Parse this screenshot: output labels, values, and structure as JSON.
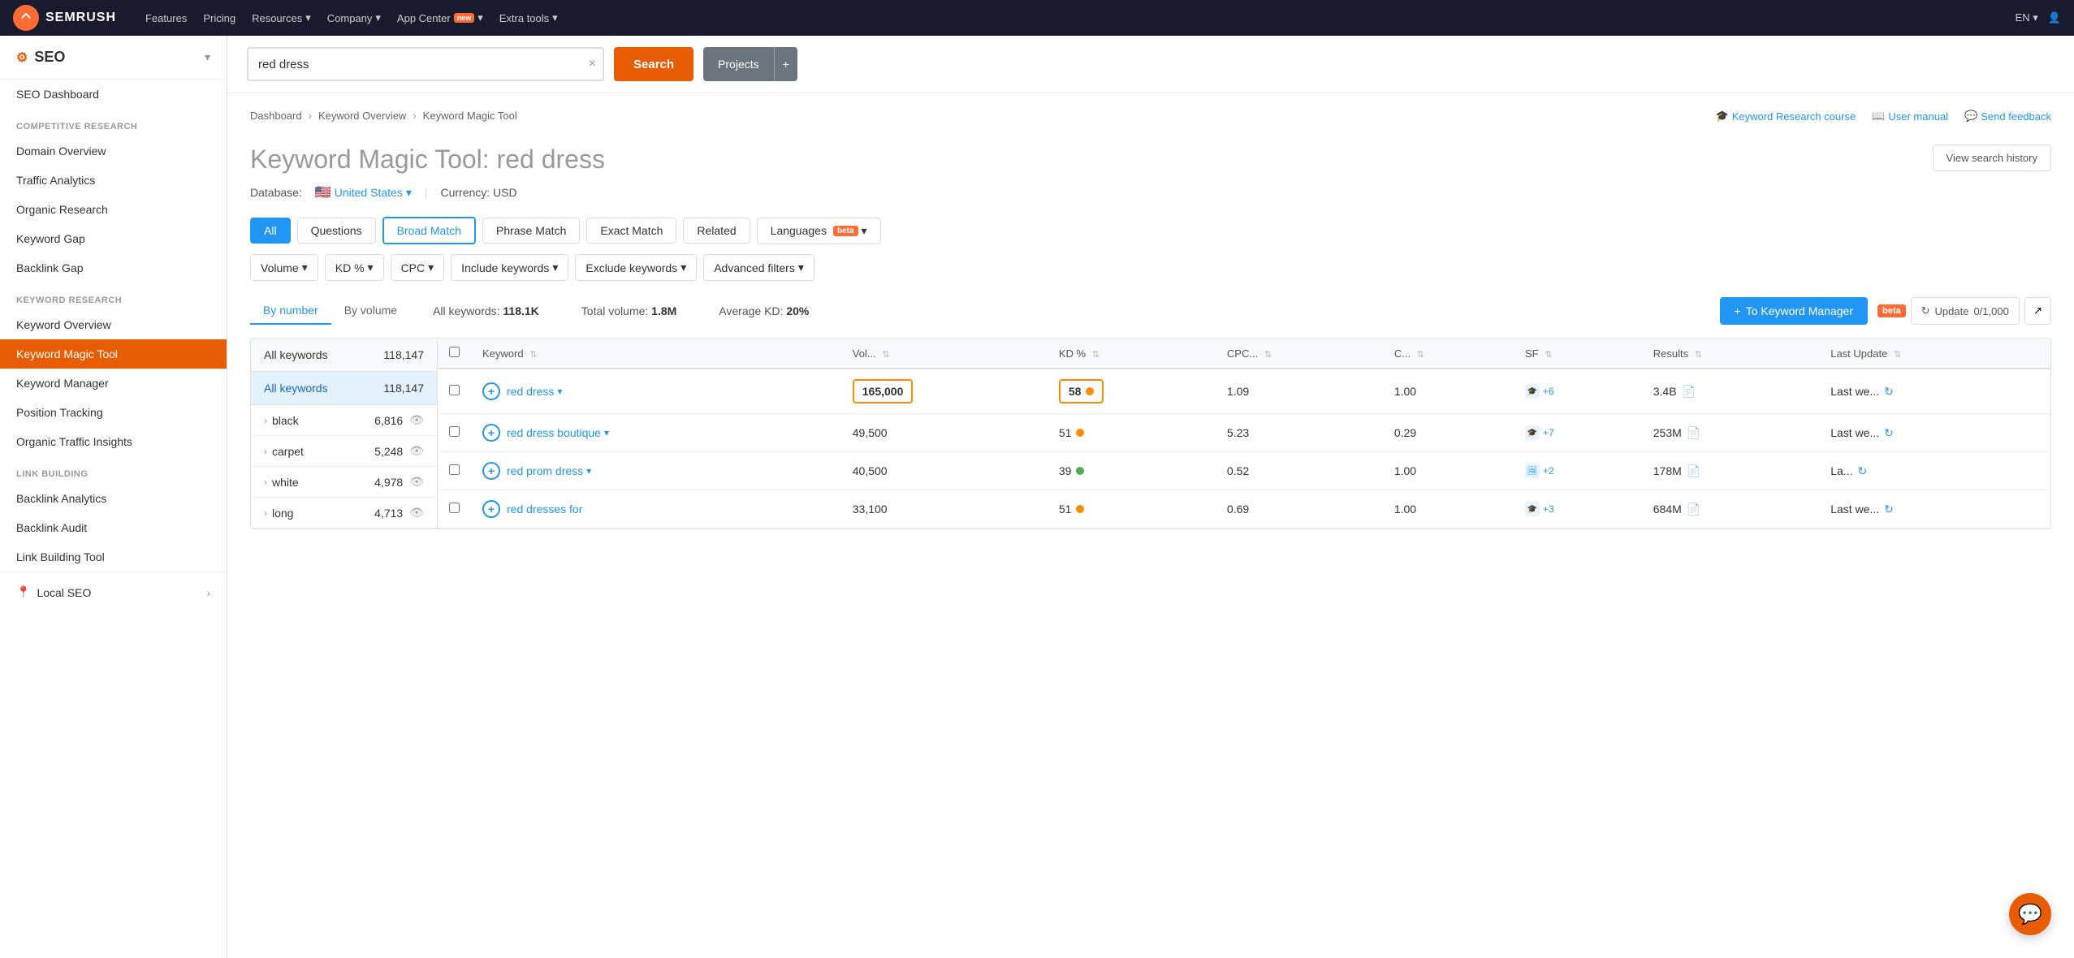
{
  "topnav": {
    "logo_text": "SEMRUSH",
    "links": [
      {
        "label": "Features",
        "has_dropdown": false
      },
      {
        "label": "Pricing",
        "has_dropdown": false
      },
      {
        "label": "Resources",
        "has_dropdown": true
      },
      {
        "label": "Company",
        "has_dropdown": true
      },
      {
        "label": "App Center",
        "has_dropdown": true,
        "badge": "new"
      },
      {
        "label": "Extra tools",
        "has_dropdown": true
      }
    ],
    "lang": "EN",
    "lang_has_dropdown": true
  },
  "sidebar": {
    "title": "SEO",
    "sections": [
      {
        "label": "",
        "items": [
          {
            "label": "SEO Dashboard",
            "active": false
          }
        ]
      },
      {
        "label": "COMPETITIVE RESEARCH",
        "items": [
          {
            "label": "Domain Overview",
            "active": false
          },
          {
            "label": "Traffic Analytics",
            "active": false
          },
          {
            "label": "Organic Research",
            "active": false
          },
          {
            "label": "Keyword Gap",
            "active": false
          },
          {
            "label": "Backlink Gap",
            "active": false
          }
        ]
      },
      {
        "label": "KEYWORD RESEARCH",
        "items": [
          {
            "label": "Keyword Overview",
            "active": false
          },
          {
            "label": "Keyword Magic Tool",
            "active": true
          },
          {
            "label": "Keyword Manager",
            "active": false
          },
          {
            "label": "Position Tracking",
            "active": false
          },
          {
            "label": "Organic Traffic Insights",
            "active": false
          }
        ]
      },
      {
        "label": "LINK BUILDING",
        "items": [
          {
            "label": "Backlink Analytics",
            "active": false
          },
          {
            "label": "Backlink Audit",
            "active": false
          },
          {
            "label": "Link Building Tool",
            "active": false
          }
        ]
      }
    ],
    "footer": "Local SEO"
  },
  "search": {
    "placeholder": "red dress",
    "value": "red dress",
    "search_label": "Search",
    "projects_label": "Projects"
  },
  "breadcrumb": {
    "items": [
      "Dashboard",
      "Keyword Overview",
      "Keyword Magic Tool"
    ]
  },
  "help_links": [
    {
      "label": "Keyword Research course",
      "icon": "graduation-icon"
    },
    {
      "label": "User manual",
      "icon": "book-icon"
    },
    {
      "label": "Send feedback",
      "icon": "chat-icon"
    }
  ],
  "page_title": "Keyword Magic Tool:",
  "page_subtitle": "red dress",
  "database": {
    "label": "Database:",
    "country": "United States",
    "currency_label": "Currency: USD"
  },
  "tabs": {
    "match_tabs": [
      {
        "label": "All",
        "active_blue": true
      },
      {
        "label": "Questions",
        "active": false
      },
      {
        "label": "Broad Match",
        "active_outline": true
      },
      {
        "label": "Phrase Match",
        "active": false
      },
      {
        "label": "Exact Match",
        "active": false
      },
      {
        "label": "Related",
        "active": false
      },
      {
        "label": "Languages",
        "active": false,
        "badge": "beta"
      }
    ],
    "filter_btns": [
      {
        "label": "Volume"
      },
      {
        "label": "KD %"
      },
      {
        "label": "CPC"
      },
      {
        "label": "Include keywords"
      },
      {
        "label": "Exclude keywords"
      },
      {
        "label": "Advanced filters"
      }
    ]
  },
  "stats": {
    "all_keywords_label": "All keywords:",
    "all_keywords_value": "118.1K",
    "total_volume_label": "Total volume:",
    "total_volume_value": "1.8M",
    "avg_kd_label": "Average KD:",
    "avg_kd_value": "20%",
    "to_kw_manager_label": "To Keyword Manager",
    "update_label": "Update",
    "update_count": "0/1,000",
    "beta_label": "beta"
  },
  "sort_tabs": [
    {
      "label": "By number",
      "active": true
    },
    {
      "label": "By volume",
      "active": false
    }
  ],
  "left_panel": {
    "header_label": "All keywords",
    "header_count": "118,147",
    "groups": [
      {
        "name": "black",
        "count": "6,816"
      },
      {
        "name": "carpet",
        "count": "5,248"
      },
      {
        "name": "white",
        "count": "4,978"
      },
      {
        "name": "long",
        "count": "4,713"
      }
    ]
  },
  "table": {
    "columns": [
      {
        "label": "Keyword",
        "key": "keyword"
      },
      {
        "label": "Vol...",
        "key": "volume"
      },
      {
        "label": "KD %",
        "key": "kd"
      },
      {
        "label": "CPC...",
        "key": "cpc"
      },
      {
        "label": "C...",
        "key": "com"
      },
      {
        "label": "SF",
        "key": "sf"
      },
      {
        "label": "Results",
        "key": "results"
      },
      {
        "label": "Last Update",
        "key": "last_update"
      }
    ],
    "rows": [
      {
        "keyword": "red dress",
        "volume": "165,000",
        "volume_highlighted": true,
        "kd": "58",
        "kd_highlighted": true,
        "kd_dot": "orange",
        "cpc": "1.09",
        "com": "1.00",
        "sf_icons": 1,
        "sf_plus": "+6",
        "results": "3.4B",
        "last_update": "Last we..."
      },
      {
        "keyword": "red dress boutique",
        "volume": "49,500",
        "volume_highlighted": false,
        "kd": "51",
        "kd_highlighted": false,
        "kd_dot": "orange",
        "cpc": "5.23",
        "com": "0.29",
        "sf_icons": 1,
        "sf_plus": "+7",
        "results": "253M",
        "last_update": "Last we..."
      },
      {
        "keyword": "red prom dress",
        "volume": "40,500",
        "volume_highlighted": false,
        "kd": "39",
        "kd_highlighted": false,
        "kd_dot": "green",
        "cpc": "0.52",
        "com": "1.00",
        "sf_icons": 1,
        "sf_plus": "+2",
        "results": "178M",
        "last_update": "La..."
      },
      {
        "keyword": "red dresses for",
        "volume": "33,100",
        "volume_highlighted": false,
        "kd": "51",
        "kd_highlighted": false,
        "kd_dot": "orange",
        "cpc": "0.69",
        "com": "1.00",
        "sf_icons": 1,
        "sf_plus": "+3",
        "results": "684M",
        "last_update": "Last we..."
      }
    ]
  },
  "chat_button": {
    "tooltip": "Chat support"
  }
}
